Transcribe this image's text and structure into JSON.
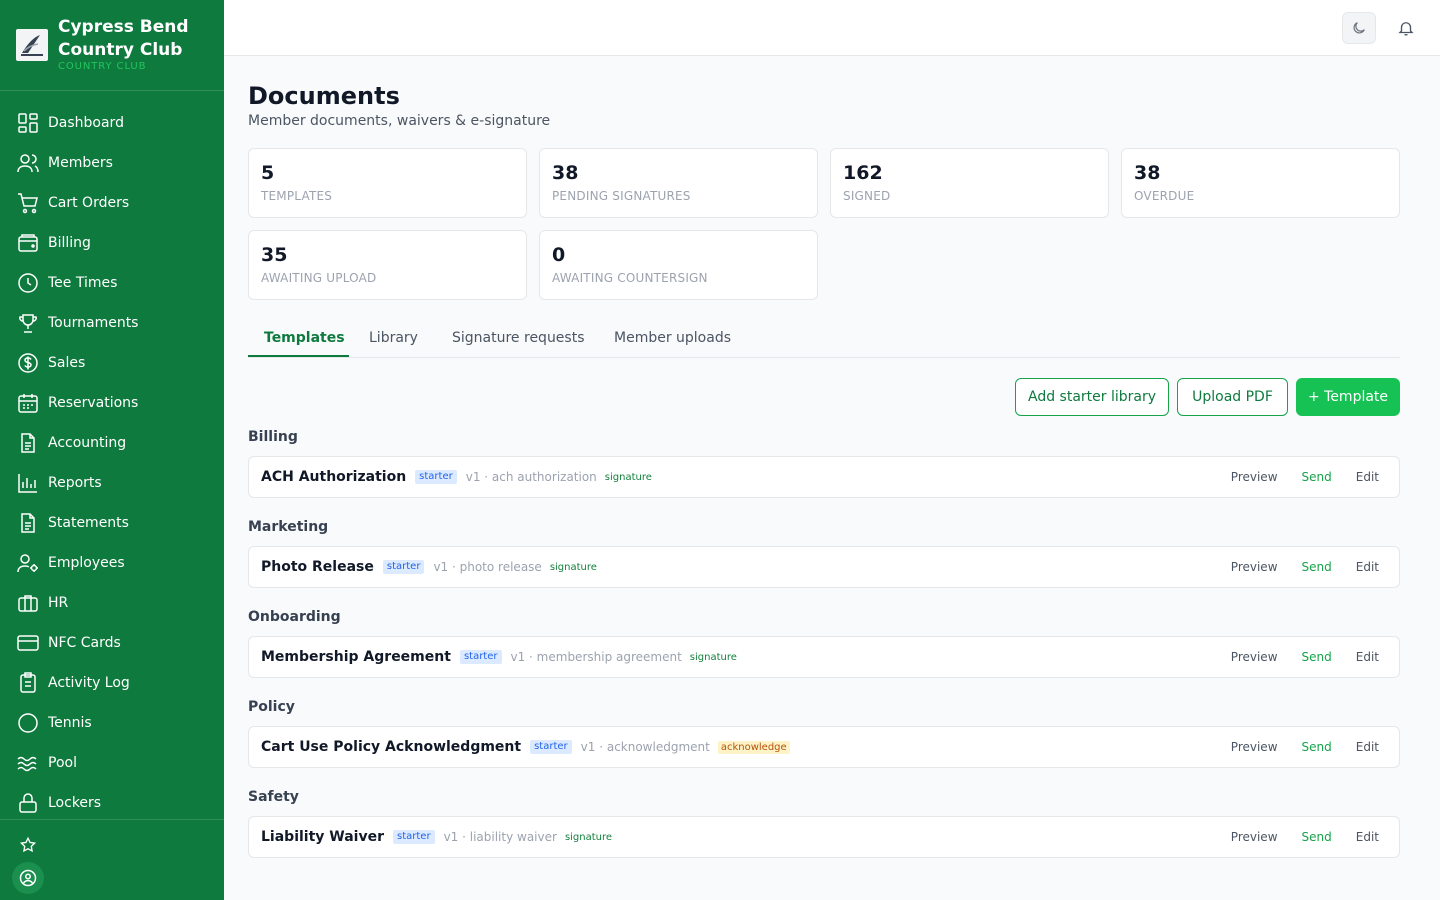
{
  "brand": {
    "name": "Cypress Bend Country Club",
    "subtitle": "COUNTRY CLUB"
  },
  "sidebar": {
    "items": [
      {
        "label": "Dashboard",
        "icon": "dashboard-icon"
      },
      {
        "label": "Members",
        "icon": "users-icon"
      },
      {
        "label": "Cart Orders",
        "icon": "cart-icon"
      },
      {
        "label": "Billing",
        "icon": "wallet-icon"
      },
      {
        "label": "Tee Times",
        "icon": "clock-icon"
      },
      {
        "label": "Tournaments",
        "icon": "trophy-icon"
      },
      {
        "label": "Sales",
        "icon": "dollar-icon"
      },
      {
        "label": "Reservations",
        "icon": "calendar-icon"
      },
      {
        "label": "Accounting",
        "icon": "document-icon"
      },
      {
        "label": "Reports",
        "icon": "bar-chart-icon"
      },
      {
        "label": "Statements",
        "icon": "document-icon"
      },
      {
        "label": "Employees",
        "icon": "user-gear-icon"
      },
      {
        "label": "HR",
        "icon": "briefcase-icon"
      },
      {
        "label": "NFC Cards",
        "icon": "credit-card-icon"
      },
      {
        "label": "Activity Log",
        "icon": "clipboard-icon"
      },
      {
        "label": "Tennis",
        "icon": "circle-icon"
      },
      {
        "label": "Pool",
        "icon": "waves-icon"
      },
      {
        "label": "Lockers",
        "icon": "lock-icon"
      }
    ]
  },
  "header": {
    "title": "Documents",
    "subtitle": "Member documents, waivers & e-signature"
  },
  "stats": [
    {
      "value": "5",
      "label": "TEMPLATES"
    },
    {
      "value": "38",
      "label": "PENDING SIGNATURES"
    },
    {
      "value": "162",
      "label": "SIGNED"
    },
    {
      "value": "38",
      "label": "OVERDUE"
    },
    {
      "value": "35",
      "label": "AWAITING UPLOAD"
    },
    {
      "value": "0",
      "label": "AWAITING COUNTERSIGN"
    }
  ],
  "tabs": [
    {
      "label": "Templates",
      "active": true
    },
    {
      "label": "Library",
      "active": false
    },
    {
      "label": "Signature requests",
      "active": false
    },
    {
      "label": "Member uploads",
      "active": false
    }
  ],
  "toolbar": {
    "starter_label": "Add starter library",
    "upload_label": "Upload PDF",
    "template_label": "+ Template"
  },
  "groups": [
    {
      "name": "Billing",
      "item": {
        "name": "ACH Authorization",
        "badge": "starter",
        "meta": "v1 · ach authorization",
        "type": "signature"
      }
    },
    {
      "name": "Marketing",
      "item": {
        "name": "Photo Release",
        "badge": "starter",
        "meta": "v1 · photo release",
        "type": "signature"
      }
    },
    {
      "name": "Onboarding",
      "item": {
        "name": "Membership Agreement",
        "badge": "starter",
        "meta": "v1 · membership agreement",
        "type": "signature"
      }
    },
    {
      "name": "Policy",
      "item": {
        "name": "Cart Use Policy Acknowledgment",
        "badge": "starter",
        "meta": "v1 · acknowledgment",
        "type": "acknowledge"
      }
    },
    {
      "name": "Safety",
      "item": {
        "name": "Liability Waiver",
        "badge": "starter",
        "meta": "v1 · liability waiver",
        "type": "signature"
      }
    }
  ],
  "row_actions": {
    "preview": "Preview",
    "send": "Send",
    "edit": "Edit"
  },
  "colors": {
    "sidebar": "#0e7a3e",
    "accent": "#16c253",
    "starter_badge": "#dbeafe"
  }
}
